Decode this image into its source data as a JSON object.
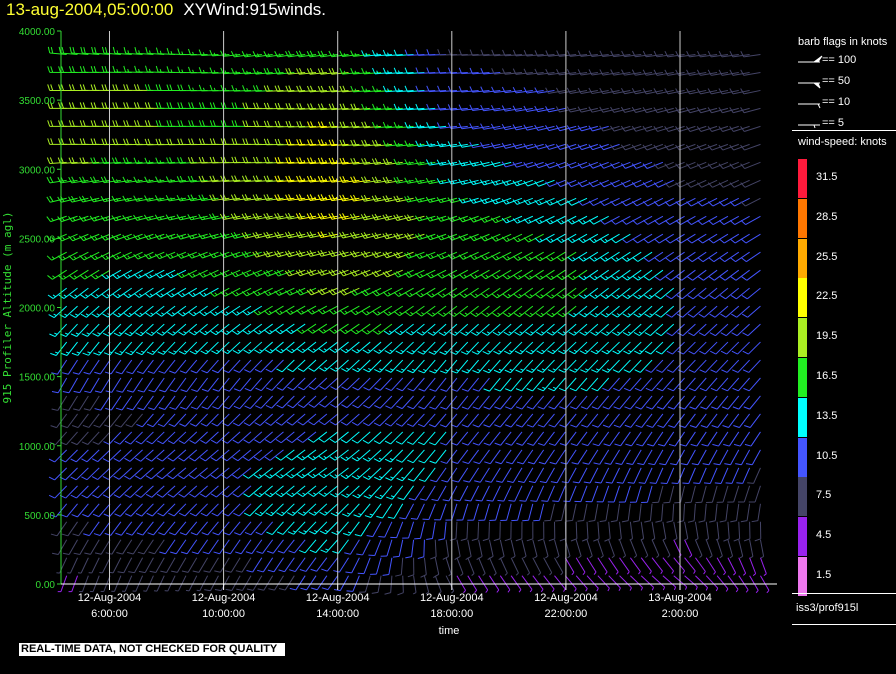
{
  "header": {
    "date": "13-aug-2004,05:00:00",
    "product": "XYWind:915winds."
  },
  "note": "REAL-TIME DATA, NOT CHECKED FOR QUALITY",
  "station": "iss3/prof915l",
  "legend": {
    "barb_title": "barb flags in knots",
    "barbs": [
      {
        "label": "== 100",
        "value": 100
      },
      {
        "label": "== 50",
        "value": 50
      },
      {
        "label": "== 10",
        "value": 10
      },
      {
        "label": "== 5",
        "value": 5
      }
    ],
    "speed_title": "wind-speed: knots",
    "colors": [
      {
        "label": "31.5",
        "color": "#ff1a3c"
      },
      {
        "label": "28.5",
        "color": "#ff7700"
      },
      {
        "label": "25.5",
        "color": "#ffaa00"
      },
      {
        "label": "22.5",
        "color": "#ffff00"
      },
      {
        "label": "19.5",
        "color": "#aaee22"
      },
      {
        "label": "16.5",
        "color": "#22ee22"
      },
      {
        "label": "13.5",
        "color": "#00ffff"
      },
      {
        "label": "10.5",
        "color": "#4455ff"
      },
      {
        "label": "7.5",
        "color": "#444466"
      },
      {
        "label": "4.5",
        "color": "#9922ee"
      },
      {
        "label": "1.5",
        "color": "#ee77ee"
      }
    ]
  },
  "chart_data": {
    "type": "scatter",
    "title": "",
    "xlabel": "time",
    "ylabel": "915 Profiler Altitude (m agl)",
    "ylim": [
      0,
      4000
    ],
    "yticks": [
      "0.00",
      "500.00",
      "1000.00",
      "1500.00",
      "2000.00",
      "2500.00",
      "3000.00",
      "3500.00",
      "4000.00"
    ],
    "xlim_hours": [
      4.3,
      29.4
    ],
    "xticks": [
      {
        "hour": 6,
        "line1": "12-Aug-2004",
        "line2": "6:00:00"
      },
      {
        "hour": 10,
        "line1": "12-Aug-2004",
        "line2": "10:00:00"
      },
      {
        "hour": 14,
        "line1": "12-Aug-2004",
        "line2": "14:00:00"
      },
      {
        "hour": 18,
        "line1": "12-Aug-2004",
        "line2": "18:00:00"
      },
      {
        "hour": 22,
        "line1": "12-Aug-2004",
        "line2": "22:00:00"
      },
      {
        "hour": 26,
        "line1": "13-Aug-2004",
        "line2": "2:00:00"
      }
    ],
    "grid": "vertical lines at x ticks",
    "axis_color": "#33dd33",
    "series": [
      {
        "values_description": "",
        "profiles": [
          {
            "t": 5.0,
            "spd": [
              6,
              7,
              8,
              9,
              10,
              10,
              10,
              9,
              8,
              8,
              9,
              11,
              12,
              13,
              14,
              15,
              15,
              16,
              17,
              17,
              18,
              18,
              18,
              19,
              19,
              19,
              19,
              18,
              18,
              18
            ],
            "dir": [
              200,
              205,
              210,
              215,
              220,
              225,
              225,
              225,
              220,
              215,
              210,
              210,
              215,
              220,
              225,
              230,
              235,
              240,
              245,
              250,
              255,
              260,
              265,
              270,
              270,
              270,
              270,
              270,
              275,
              275
            ]
          },
          {
            "t": 8.0,
            "spd": [
              7,
              8,
              9,
              10,
              11,
              11,
              11,
              10,
              10,
              9,
              10,
              11,
              12,
              13,
              13,
              14,
              14,
              15,
              15,
              16,
              16,
              17,
              17,
              18,
              18,
              18,
              18,
              17,
              17,
              17
            ],
            "dir": [
              205,
              210,
              215,
              220,
              225,
              228,
              230,
              228,
              225,
              220,
              215,
              215,
              220,
              225,
              230,
              235,
              240,
              245,
              250,
              255,
              260,
              262,
              265,
              268,
              270,
              270,
              270,
              272,
              274,
              275
            ]
          },
          {
            "t": 11.0,
            "spd": [
              8,
              9,
              10,
              11,
              12,
              12,
              12,
              11,
              11,
              10,
              10,
              11,
              12,
              13,
              14,
              15,
              16,
              17,
              18,
              18,
              19,
              19,
              19,
              19,
              18,
              18,
              17,
              17,
              17,
              16
            ],
            "dir": [
              210,
              212,
              215,
              220,
              225,
              230,
              232,
              230,
              228,
              225,
              220,
              220,
              225,
              230,
              235,
              240,
              245,
              250,
              255,
              258,
              262,
              265,
              268,
              270,
              270,
              270,
              268,
              265,
              262,
              260
            ]
          },
          {
            "t": 14.0,
            "spd": [
              10,
              11,
              13,
              14,
              15,
              15,
              14,
              13,
              12,
              11,
              11,
              12,
              13,
              15,
              16,
              18,
              19,
              20,
              21,
              22,
              23,
              24,
              24,
              23,
              22,
              21,
              20,
              19,
              18,
              18
            ],
            "dir": [
              215,
              218,
              222,
              225,
              228,
              232,
              235,
              234,
              232,
              230,
              228,
              228,
              230,
              235,
              240,
              245,
              250,
              255,
              258,
              260,
              262,
              264,
              265,
              266,
              266,
              266,
              265,
              264,
              262,
              260
            ]
          },
          {
            "t": 18.0,
            "spd": [
              6,
              7,
              8,
              9,
              10,
              11,
              12,
              12,
              12,
              11,
              11,
              12,
              13,
              14,
              15,
              16,
              17,
              17,
              17,
              17,
              16,
              15,
              14,
              13,
              12,
              11,
              10,
              10,
              9,
              9
            ],
            "dir": [
              150,
              160,
              170,
              185,
              200,
              210,
              215,
              218,
              220,
              220,
              218,
              218,
              220,
              225,
              230,
              235,
              240,
              245,
              250,
              252,
              255,
              258,
              260,
              262,
              264,
              265,
              266,
              267,
              268,
              270
            ]
          },
          {
            "t": 22.0,
            "spd": [
              5,
              6,
              7,
              8,
              9,
              10,
              11,
              12,
              12,
              12,
              12,
              13,
              14,
              15,
              15,
              16,
              16,
              16,
              15,
              14,
              13,
              12,
              11,
              10,
              10,
              9,
              9,
              8,
              8,
              8
            ],
            "dir": [
              140,
              150,
              165,
              180,
              195,
              205,
              210,
              215,
              218,
              220,
              220,
              222,
              225,
              228,
              230,
              232,
              235,
              238,
              240,
              242,
              245,
              248,
              250,
              252,
              255,
              258,
              260,
              262,
              264,
              265
            ]
          },
          {
            "t": 26.0,
            "spd": [
              4,
              5,
              6,
              7,
              8,
              9,
              10,
              10,
              11,
              11,
              11,
              11,
              12,
              12,
              12,
              12,
              12,
              11,
              11,
              10,
              10,
              9,
              9,
              8,
              8,
              8,
              9,
              9,
              9,
              9
            ],
            "dir": [
              130,
              140,
              155,
              170,
              185,
              195,
              205,
              210,
              215,
              218,
              220,
              222,
              224,
              226,
              228,
              230,
              232,
              235,
              238,
              240,
              242,
              245,
              248,
              250,
              252,
              255,
              258,
              260,
              262,
              264
            ]
          },
          {
            "t": 28.5,
            "spd": [
              5,
              6,
              7,
              8,
              8,
              9,
              9,
              10,
              10,
              10,
              10,
              10,
              11,
              11,
              11,
              11,
              11,
              10,
              10,
              10,
              9,
              9,
              9,
              9,
              9,
              9,
              9,
              9,
              9,
              9
            ],
            "dir": [
              150,
              160,
              170,
              180,
              190,
              200,
              205,
              210,
              215,
              218,
              220,
              222,
              224,
              226,
              228,
              230,
              232,
              235,
              238,
              240,
              242,
              245,
              248,
              250,
              252,
              255,
              258,
              260,
              262,
              264
            ]
          }
        ]
      }
    ]
  }
}
